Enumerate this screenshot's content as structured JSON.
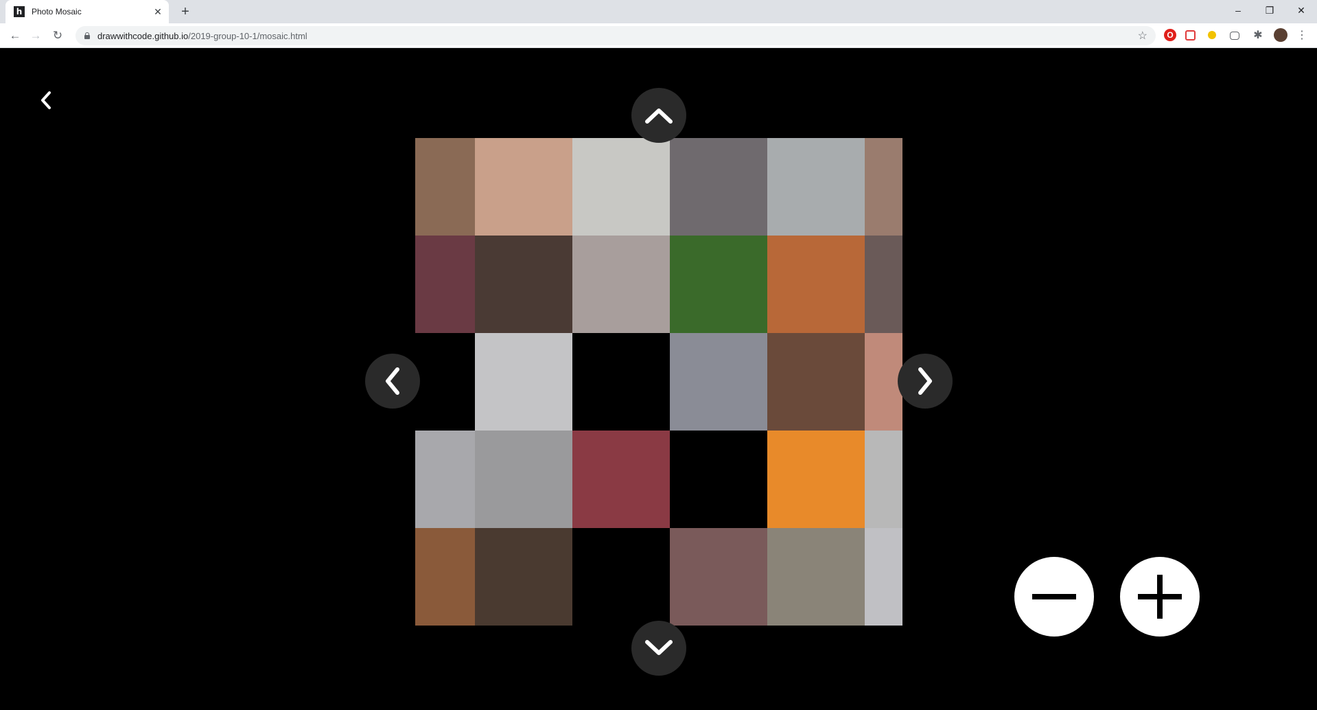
{
  "browser": {
    "tab_title": "Photo Mosaic",
    "tab_favicon": "h",
    "url_host": "drawwithcode.github.io",
    "url_path": "/2019-group-10-1/mosaic.html"
  },
  "page": {
    "icons": {
      "back": "chevron-left-icon",
      "up": "chevron-up-icon",
      "down": "chevron-down-icon",
      "left": "chevron-left-icon",
      "right": "chevron-right-icon",
      "zoom_out": "minus-icon",
      "zoom_in": "plus-icon"
    },
    "mosaic_tiles": [
      [
        "#8a6a55",
        "#c9a08a",
        "#c8c8c4",
        "#6f6a6e",
        "#a8acae",
        "#9a7c6e"
      ],
      [
        "#6a3a44",
        "#4a3a34",
        "#a89e9c",
        "#3a6a2a",
        "#b86838",
        "#6a5a58"
      ],
      [
        "#000000",
        "#c4c4c6",
        "#000000",
        "#8a8c96",
        "#6a4a3a",
        "#c08a7a"
      ],
      [
        "#a8a8ac",
        "#9a9a9c",
        "#8a3a44",
        "#000000",
        "#e88a2a",
        "#b8b8b8"
      ],
      [
        "#8a5a3a",
        "#4a3a30",
        "#000000",
        "#7a5a5a",
        "#8a8478",
        "#c0c0c4"
      ]
    ]
  }
}
